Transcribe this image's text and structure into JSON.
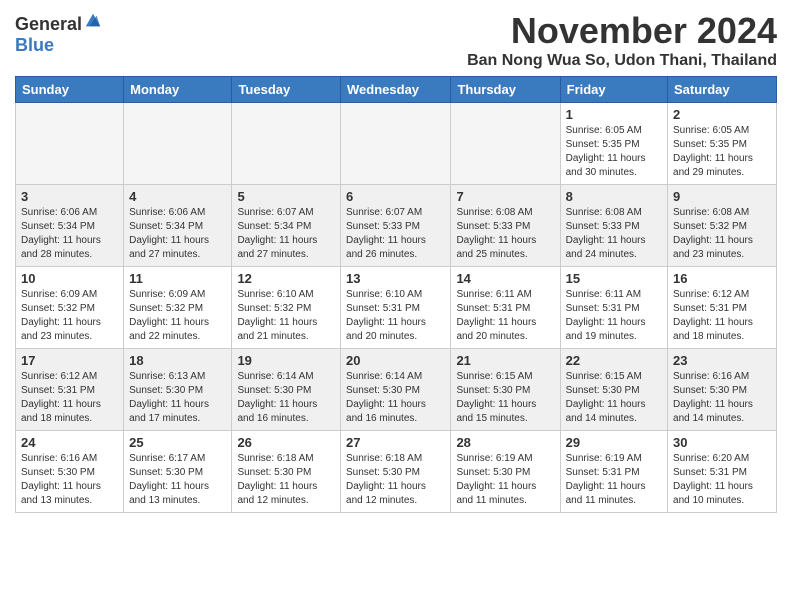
{
  "header": {
    "logo": {
      "general": "General",
      "blue": "Blue"
    },
    "month_title": "November 2024",
    "location": "Ban Nong Wua So, Udon Thani, Thailand"
  },
  "calendar": {
    "days_of_week": [
      "Sunday",
      "Monday",
      "Tuesday",
      "Wednesday",
      "Thursday",
      "Friday",
      "Saturday"
    ],
    "weeks": [
      {
        "style": "white",
        "days": [
          {
            "number": "",
            "info": "",
            "empty": true
          },
          {
            "number": "",
            "info": "",
            "empty": true
          },
          {
            "number": "",
            "info": "",
            "empty": true
          },
          {
            "number": "",
            "info": "",
            "empty": true
          },
          {
            "number": "",
            "info": "",
            "empty": true
          },
          {
            "number": "1",
            "info": "Sunrise: 6:05 AM\nSunset: 5:35 PM\nDaylight: 11 hours\nand 30 minutes."
          },
          {
            "number": "2",
            "info": "Sunrise: 6:05 AM\nSunset: 5:35 PM\nDaylight: 11 hours\nand 29 minutes."
          }
        ]
      },
      {
        "style": "gray",
        "days": [
          {
            "number": "3",
            "info": "Sunrise: 6:06 AM\nSunset: 5:34 PM\nDaylight: 11 hours\nand 28 minutes."
          },
          {
            "number": "4",
            "info": "Sunrise: 6:06 AM\nSunset: 5:34 PM\nDaylight: 11 hours\nand 27 minutes."
          },
          {
            "number": "5",
            "info": "Sunrise: 6:07 AM\nSunset: 5:34 PM\nDaylight: 11 hours\nand 27 minutes."
          },
          {
            "number": "6",
            "info": "Sunrise: 6:07 AM\nSunset: 5:33 PM\nDaylight: 11 hours\nand 26 minutes."
          },
          {
            "number": "7",
            "info": "Sunrise: 6:08 AM\nSunset: 5:33 PM\nDaylight: 11 hours\nand 25 minutes."
          },
          {
            "number": "8",
            "info": "Sunrise: 6:08 AM\nSunset: 5:33 PM\nDaylight: 11 hours\nand 24 minutes."
          },
          {
            "number": "9",
            "info": "Sunrise: 6:08 AM\nSunset: 5:32 PM\nDaylight: 11 hours\nand 23 minutes."
          }
        ]
      },
      {
        "style": "white",
        "days": [
          {
            "number": "10",
            "info": "Sunrise: 6:09 AM\nSunset: 5:32 PM\nDaylight: 11 hours\nand 23 minutes."
          },
          {
            "number": "11",
            "info": "Sunrise: 6:09 AM\nSunset: 5:32 PM\nDaylight: 11 hours\nand 22 minutes."
          },
          {
            "number": "12",
            "info": "Sunrise: 6:10 AM\nSunset: 5:32 PM\nDaylight: 11 hours\nand 21 minutes."
          },
          {
            "number": "13",
            "info": "Sunrise: 6:10 AM\nSunset: 5:31 PM\nDaylight: 11 hours\nand 20 minutes."
          },
          {
            "number": "14",
            "info": "Sunrise: 6:11 AM\nSunset: 5:31 PM\nDaylight: 11 hours\nand 20 minutes."
          },
          {
            "number": "15",
            "info": "Sunrise: 6:11 AM\nSunset: 5:31 PM\nDaylight: 11 hours\nand 19 minutes."
          },
          {
            "number": "16",
            "info": "Sunrise: 6:12 AM\nSunset: 5:31 PM\nDaylight: 11 hours\nand 18 minutes."
          }
        ]
      },
      {
        "style": "gray",
        "days": [
          {
            "number": "17",
            "info": "Sunrise: 6:12 AM\nSunset: 5:31 PM\nDaylight: 11 hours\nand 18 minutes."
          },
          {
            "number": "18",
            "info": "Sunrise: 6:13 AM\nSunset: 5:30 PM\nDaylight: 11 hours\nand 17 minutes."
          },
          {
            "number": "19",
            "info": "Sunrise: 6:14 AM\nSunset: 5:30 PM\nDaylight: 11 hours\nand 16 minutes."
          },
          {
            "number": "20",
            "info": "Sunrise: 6:14 AM\nSunset: 5:30 PM\nDaylight: 11 hours\nand 16 minutes."
          },
          {
            "number": "21",
            "info": "Sunrise: 6:15 AM\nSunset: 5:30 PM\nDaylight: 11 hours\nand 15 minutes."
          },
          {
            "number": "22",
            "info": "Sunrise: 6:15 AM\nSunset: 5:30 PM\nDaylight: 11 hours\nand 14 minutes."
          },
          {
            "number": "23",
            "info": "Sunrise: 6:16 AM\nSunset: 5:30 PM\nDaylight: 11 hours\nand 14 minutes."
          }
        ]
      },
      {
        "style": "white",
        "days": [
          {
            "number": "24",
            "info": "Sunrise: 6:16 AM\nSunset: 5:30 PM\nDaylight: 11 hours\nand 13 minutes."
          },
          {
            "number": "25",
            "info": "Sunrise: 6:17 AM\nSunset: 5:30 PM\nDaylight: 11 hours\nand 13 minutes."
          },
          {
            "number": "26",
            "info": "Sunrise: 6:18 AM\nSunset: 5:30 PM\nDaylight: 11 hours\nand 12 minutes."
          },
          {
            "number": "27",
            "info": "Sunrise: 6:18 AM\nSunset: 5:30 PM\nDaylight: 11 hours\nand 12 minutes."
          },
          {
            "number": "28",
            "info": "Sunrise: 6:19 AM\nSunset: 5:30 PM\nDaylight: 11 hours\nand 11 minutes."
          },
          {
            "number": "29",
            "info": "Sunrise: 6:19 AM\nSunset: 5:31 PM\nDaylight: 11 hours\nand 11 minutes."
          },
          {
            "number": "30",
            "info": "Sunrise: 6:20 AM\nSunset: 5:31 PM\nDaylight: 11 hours\nand 10 minutes."
          }
        ]
      }
    ]
  }
}
